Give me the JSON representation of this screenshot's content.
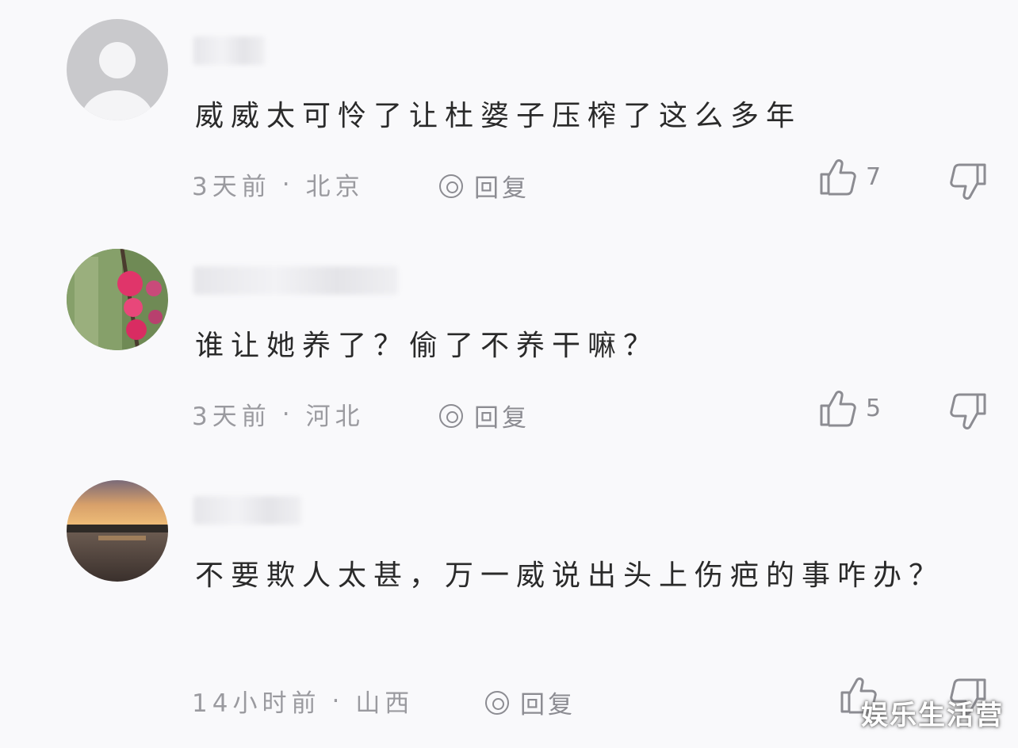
{
  "comments": [
    {
      "text": "威威太可怜了让杜婆子压榨了这么多年",
      "time": "3天前",
      "location": "北京",
      "reply_label": "回复",
      "likes": "7",
      "avatar": "default-person-icon"
    },
    {
      "text": "谁让她养了？偷了不养干嘛？",
      "time": "3天前",
      "location": "河北",
      "reply_label": "回复",
      "likes": "5",
      "avatar": "pink-flower-photo"
    },
    {
      "text": "不要欺人太甚，万一威说出头上伤疤的事咋办？",
      "time": "14小时前",
      "location": "山西",
      "reply_label": "回复",
      "likes": "",
      "avatar": "sunset-lake-photo"
    }
  ],
  "separator": "·",
  "watermark": "娱乐生活营",
  "colors": {
    "background": "#f9f9fb",
    "text": "#2a2a2a",
    "meta": "#9a9a9f"
  }
}
